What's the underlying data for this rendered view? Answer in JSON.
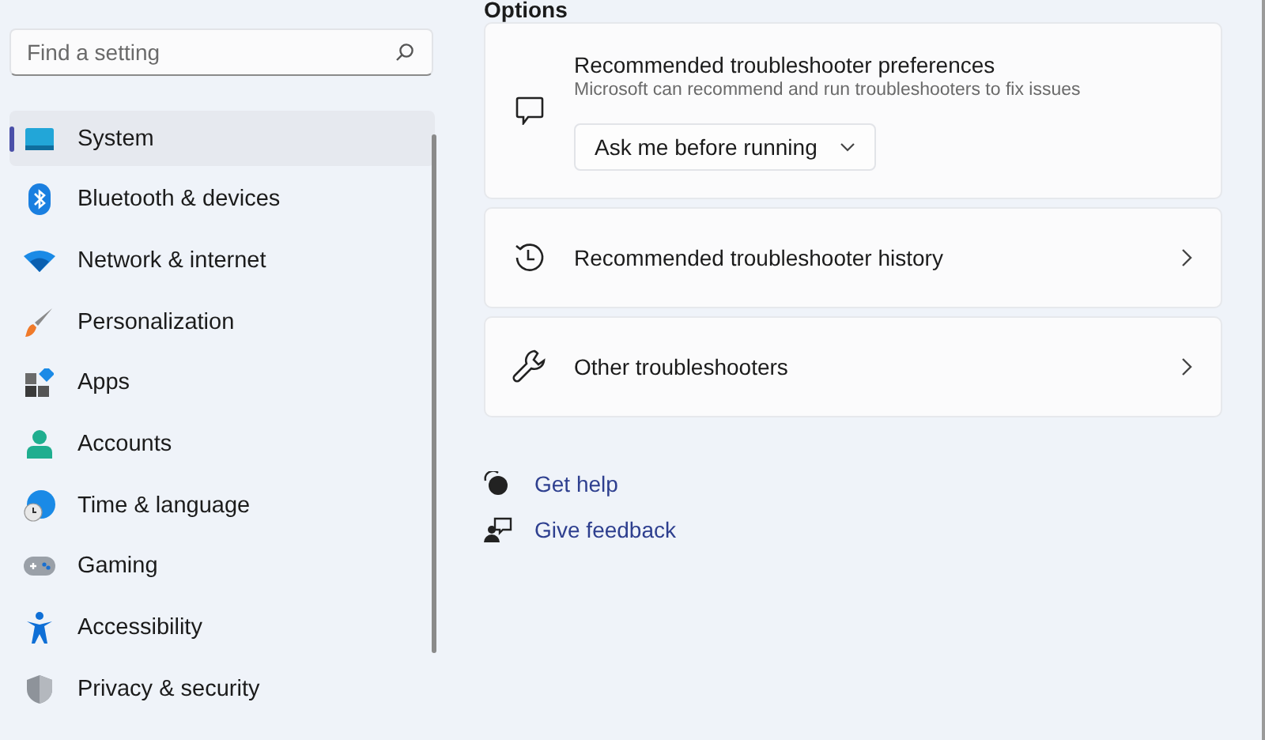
{
  "search": {
    "placeholder": "Find a setting"
  },
  "nav": [
    {
      "label": "System",
      "selected": true
    },
    {
      "label": "Bluetooth & devices",
      "selected": false
    },
    {
      "label": "Network & internet",
      "selected": false
    },
    {
      "label": "Personalization",
      "selected": false
    },
    {
      "label": "Apps",
      "selected": false
    },
    {
      "label": "Accounts",
      "selected": false
    },
    {
      "label": "Time & language",
      "selected": false
    },
    {
      "label": "Gaming",
      "selected": false
    },
    {
      "label": "Accessibility",
      "selected": false
    },
    {
      "label": "Privacy & security",
      "selected": false
    }
  ],
  "section_heading": "Options",
  "cards": [
    {
      "kind": "dropdown",
      "title": "Recommended troubleshooter preferences",
      "description": "Microsoft can recommend and run troubleshooters to fix issues",
      "value": "Ask me before running"
    },
    {
      "kind": "link",
      "title": "Recommended troubleshooter history"
    },
    {
      "kind": "link",
      "title": "Other troubleshooters"
    }
  ],
  "help_links": [
    "Get help",
    "Give feedback"
  ]
}
